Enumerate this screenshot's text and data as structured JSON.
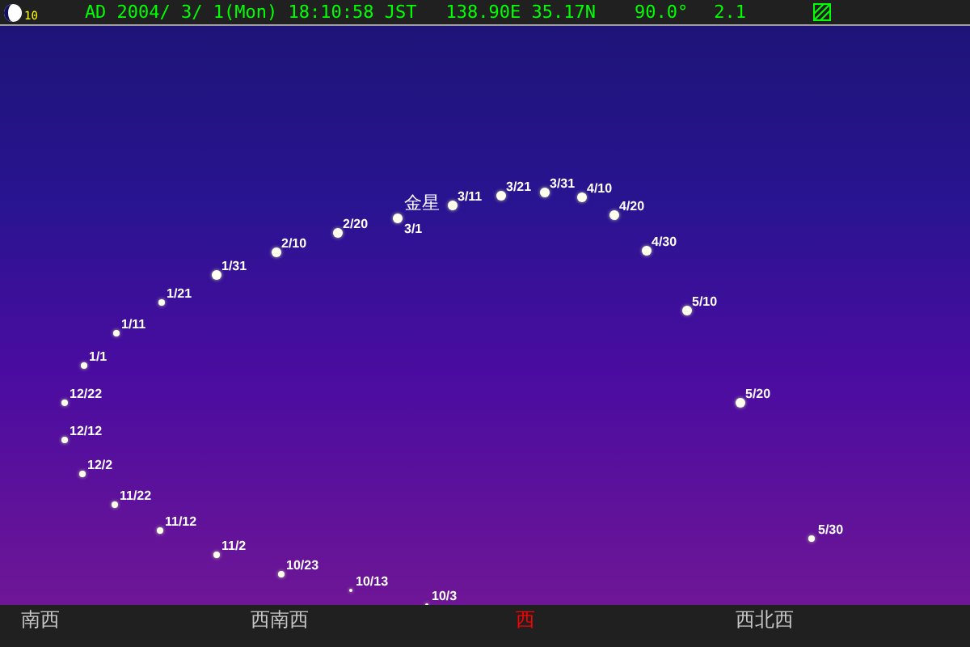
{
  "status_bar": {
    "moon_age": "10",
    "datetime": "AD 2004/ 3/ 1(Mon) 18:10:58 JST",
    "location": "138.90E 35.17N",
    "field_of_view": "90.0°",
    "magnitude": "2.1"
  },
  "planet": {
    "name": "金星"
  },
  "positions": [
    {
      "label": "1/1"
    },
    {
      "label": "1/11"
    },
    {
      "label": "1/21"
    },
    {
      "label": "1/31"
    },
    {
      "label": "2/10"
    },
    {
      "label": "2/20"
    },
    {
      "label": "3/1"
    },
    {
      "label": "3/11"
    },
    {
      "label": "3/21"
    },
    {
      "label": "3/31"
    },
    {
      "label": "4/10"
    },
    {
      "label": "4/20"
    },
    {
      "label": "4/30"
    },
    {
      "label": "5/10"
    },
    {
      "label": "5/20"
    },
    {
      "label": "5/30"
    },
    {
      "label": "12/22"
    },
    {
      "label": "12/12"
    },
    {
      "label": "12/2"
    },
    {
      "label": "11/22"
    },
    {
      "label": "11/12"
    },
    {
      "label": "11/2"
    },
    {
      "label": "10/23"
    },
    {
      "label": "10/13"
    },
    {
      "label": "10/3"
    }
  ],
  "directions": [
    {
      "label": "南西",
      "selected": false
    },
    {
      "label": "西南西",
      "selected": false
    },
    {
      "label": "西",
      "selected": true
    },
    {
      "label": "西北西",
      "selected": false
    }
  ]
}
